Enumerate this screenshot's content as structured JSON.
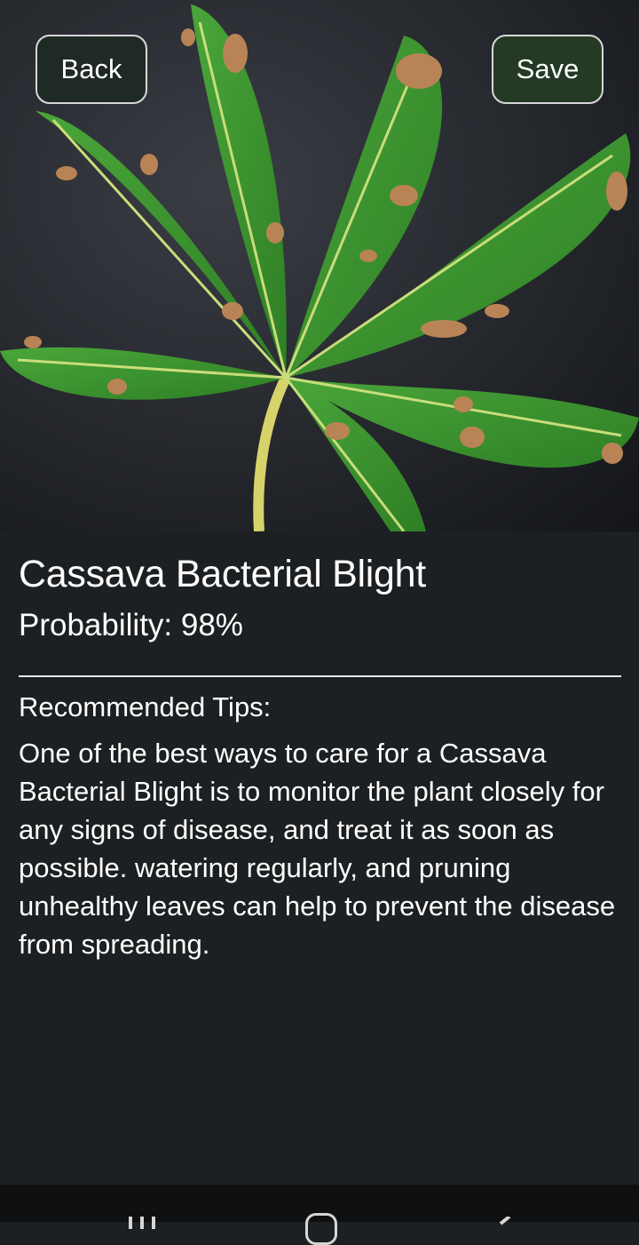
{
  "header": {
    "back_label": "Back",
    "save_label": "Save"
  },
  "hero_image": {
    "subject": "cassava leaf with bacterial blight spots",
    "background_color": "#1a1c20",
    "leaf_color": "#3f9a2f",
    "vein_color": "#c9dd7a",
    "lesion_color": "#b98455"
  },
  "result": {
    "title": "Cassava Bacterial Blight",
    "probability": "Probability: 98%"
  },
  "tips": {
    "heading": "Recommended Tips:",
    "body": "One of the best ways to care for a Cassava Bacterial Blight is to monitor the plant closely for any signs of disease, and treat it as soon as possible. watering regularly, and pruning unhealthy leaves can help to prevent the disease from spreading."
  },
  "system_nav": {
    "recents_icon": "recents-icon",
    "home_icon": "home-icon",
    "back_icon": "back-icon"
  },
  "colors": {
    "background": "#1d2022",
    "text": "#ffffff",
    "divider": "#e8e8e8",
    "back_button_bg": "#1f2a26",
    "save_button_bg": "#243a24"
  }
}
